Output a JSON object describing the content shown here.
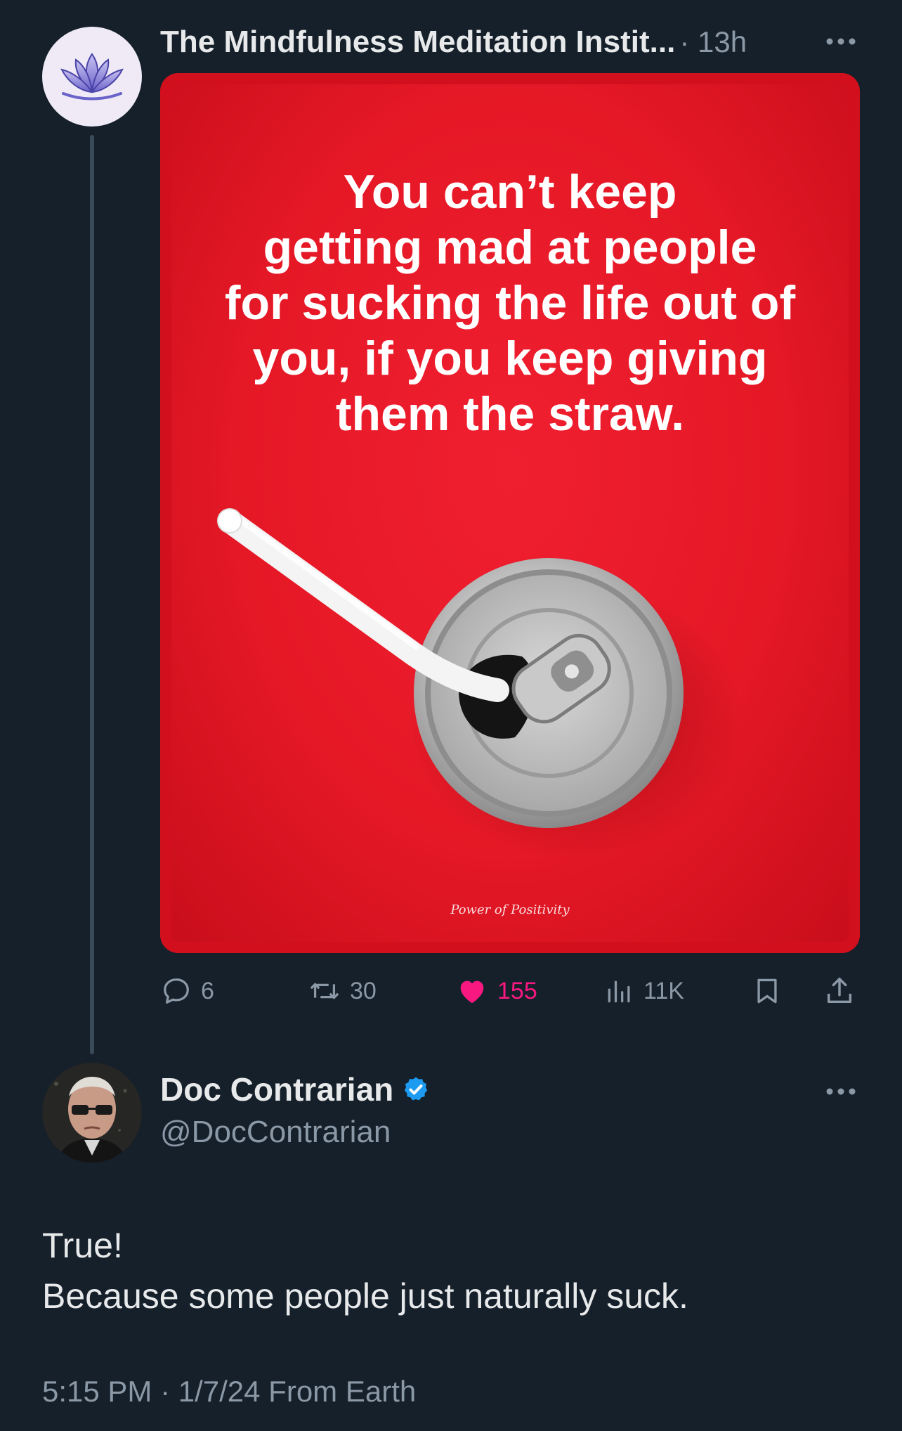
{
  "original_post": {
    "author_name": "The Mindfulness Meditation Instit...",
    "time": "· 13h",
    "avatar_icon": "lotus-icon",
    "image": {
      "quote_lines": [
        "You can’t keep",
        "getting mad at people",
        "for sucking the life out of",
        "you, if you keep giving",
        "them the straw."
      ],
      "watermark": "Power of Positivity",
      "background_color": "#e51826"
    },
    "actions": {
      "replies": "6",
      "reposts": "30",
      "likes": "155",
      "views": "11K"
    }
  },
  "reply": {
    "author_name": "Doc Contrarian",
    "handle": "@DocContrarian",
    "verified": true,
    "text_lines": [
      "True!",
      "Because some people just naturally suck."
    ],
    "meta": "5:15 PM · 1/7/24 From Earth"
  },
  "colors": {
    "background": "#15202b",
    "text_primary": "#e7e9ea",
    "text_secondary": "#8b98a5",
    "like": "#f91880",
    "verified": "#1d9bf0"
  }
}
